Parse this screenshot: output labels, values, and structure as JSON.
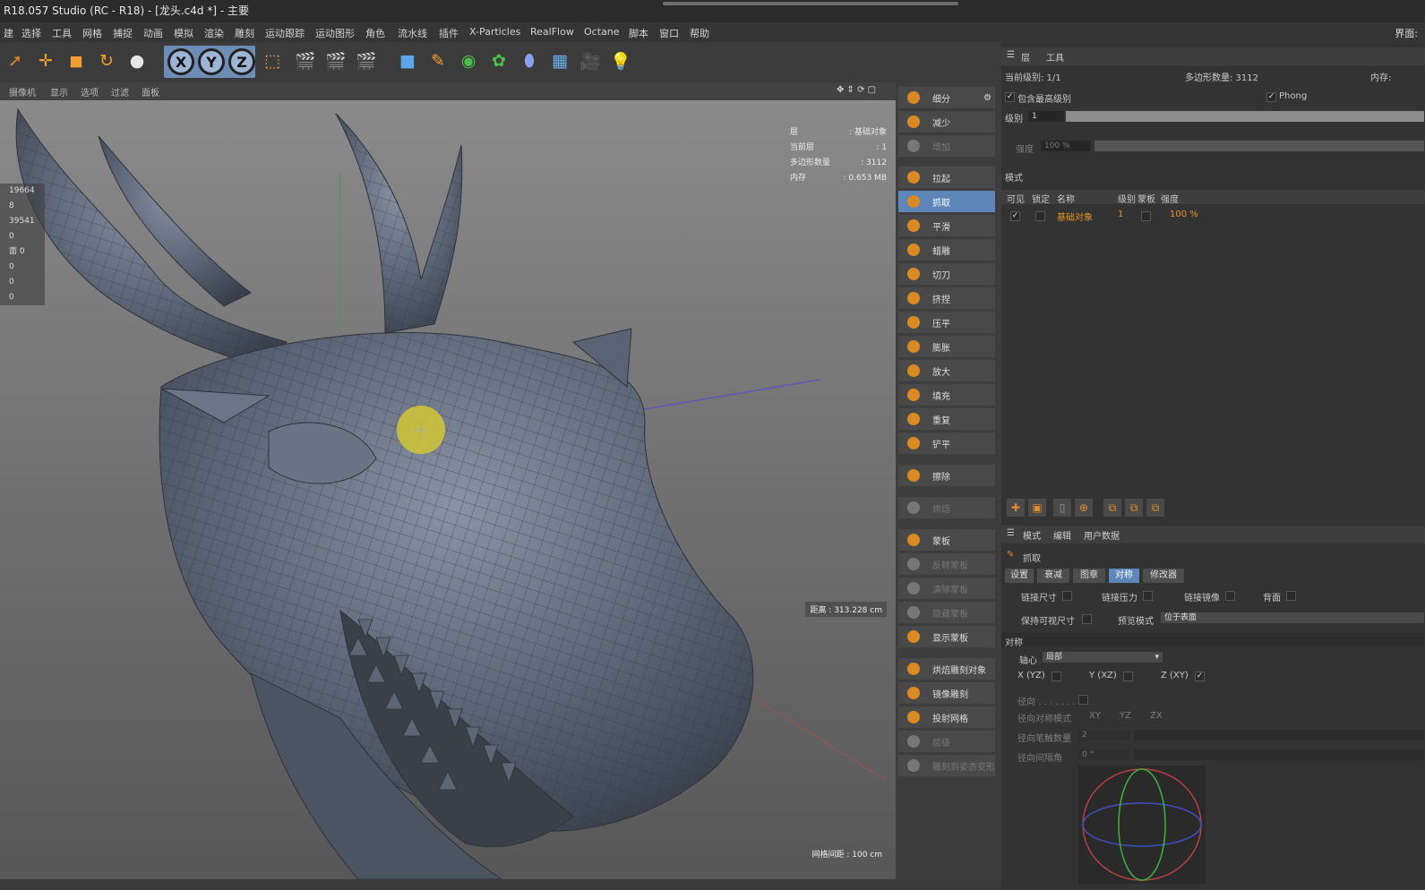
{
  "titlebar": {
    "title": "R18.057 Studio (RC - R18) - [龙头.c4d *] - 主要"
  },
  "menu": {
    "items": [
      "建",
      "选择",
      "工具",
      "网格",
      "捕捉",
      "动画",
      "模拟",
      "渲染",
      "雕刻",
      "运动跟踪",
      "运动图形",
      "角色",
      "流水线",
      "插件",
      "X-Particles",
      "RealFlow",
      "Octane",
      "脚本",
      "窗口",
      "帮助"
    ],
    "layout_label": "界面:"
  },
  "toolbar": {
    "axis_x": "X",
    "axis_y": "Y",
    "axis_z": "Z"
  },
  "viewport": {
    "menu": [
      "摄像机",
      "显示",
      "选项",
      "过滤",
      "面板"
    ],
    "hud": {
      "layer_label": "层",
      "layer_value": ": 基础对象",
      "current_label": "当前层",
      "current_value": ": 1",
      "poly_label": "多边形数量",
      "poly_value": ": 3112",
      "mem_label": "内存",
      "mem_value": ": 0.653 MB"
    },
    "stats": [
      "19664",
      "8",
      "39541",
      "0",
      "面 0",
      "0",
      "0",
      "0"
    ],
    "distance": "距离 : 313.228 cm",
    "grid_spacing": "网格间距 : 100 cm"
  },
  "brushes": {
    "group1": [
      "细分",
      "减少",
      "增加"
    ],
    "group2": [
      "拉起",
      "抓取",
      "平滑",
      "蜡雕",
      "切刀",
      "挤捏",
      "压平",
      "膨胀",
      "放大",
      "填充",
      "重复",
      "铲平"
    ],
    "erase": "擦除",
    "inactive": "烘焙",
    "group3": [
      "蒙板",
      "反转蒙板",
      "清除蒙板",
      "隐藏蒙板",
      "显示蒙板"
    ],
    "group4": [
      "烘焙雕刻对象",
      "镜像雕刻",
      "投射网格",
      "层级",
      "雕刻到姿态变形"
    ]
  },
  "layers": {
    "tabs": [
      "层",
      "工具"
    ],
    "current_level": "当前级别: 1/1",
    "poly_count": "多边形数量: 3112",
    "memory": "内存:",
    "include_top": "包含最高级别",
    "phong": "Phong",
    "level_label": "级别",
    "level_value": "1",
    "strength_label": "强度",
    "strength_value": "100 %",
    "mode_label": "模式",
    "columns": [
      "可见",
      "锁定",
      "名称",
      "级别",
      "蒙板",
      "强度"
    ],
    "row": {
      "name": "基础对象",
      "level": "1",
      "strength": "100 %"
    }
  },
  "attributes": {
    "tabs": [
      "模式",
      "编辑",
      "用户数据"
    ],
    "tool_name": "抓取",
    "subtabs": [
      "设置",
      "衰减",
      "图章",
      "对称",
      "修改器"
    ],
    "active_subtab": "对称",
    "link_size": "链接尺寸",
    "link_pressure": "链接压力",
    "link_mirror": "链接镜像",
    "back": "背面",
    "keep_visible_size": "保持可视尺寸",
    "preview_mode": "预览模式",
    "preview_value": "位于表面",
    "symmetry_header": "对称",
    "axis_label": "轴心",
    "axis_value": "局部",
    "x_yz": "X (YZ)",
    "y_xz": "Y (XZ)",
    "z_xy": "Z (XY)",
    "radial": "径向 . . . . . . .",
    "radial_mode": "径向对称模式",
    "radial_mode_opts": [
      "XY",
      "YZ",
      "ZX"
    ],
    "radial_count": "径向笔触数量",
    "radial_count_value": "2",
    "radial_angle": "径向间隔角",
    "radial_angle_value": "0 °"
  }
}
